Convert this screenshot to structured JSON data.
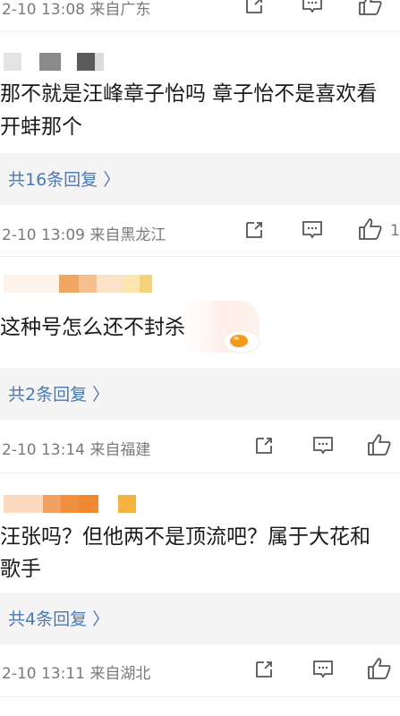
{
  "comments": [
    {
      "meta": "2-10 13:08  来自广东",
      "like_count": ""
    },
    {
      "lines": [
        "那不就是汪峰章子怡吗 章子怡不是喜欢看",
        "开蚌那个"
      ],
      "replies": "共16条回复 〉",
      "meta": "2-10 13:09  来自黑龙江",
      "like_count": "1"
    },
    {
      "lines": [
        "这种号怎么还不封杀"
      ],
      "replies": "共2条回复 〉",
      "meta": "2-10 13:14  来自福建",
      "like_count": ""
    },
    {
      "lines": [
        "汪张吗？但他两不是顶流吧？属于大花和",
        "歌手"
      ],
      "replies": "共4条回复 〉",
      "meta": "2-10 13:11  来自湖北",
      "like_count": ""
    }
  ],
  "colors": {
    "link": "#4a78b5",
    "meta": "#7a7a7a",
    "reply_bg": "#f4f4f4"
  }
}
